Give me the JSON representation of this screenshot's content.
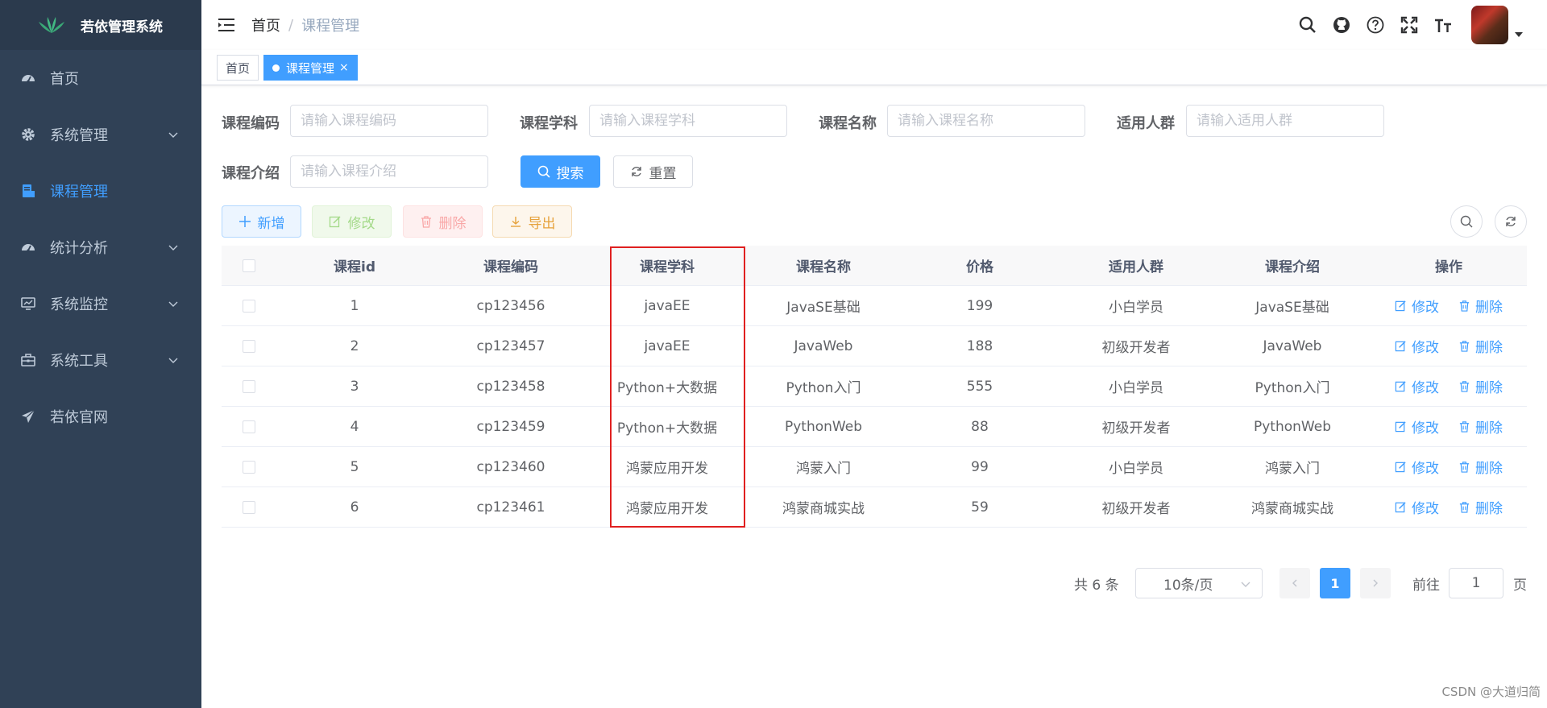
{
  "app": {
    "title": "若依管理系统"
  },
  "sidebar": {
    "items": [
      {
        "label": "首页",
        "icon": "dashboard-icon",
        "active": false,
        "expandable": false
      },
      {
        "label": "系统管理",
        "icon": "gear-icon",
        "active": false,
        "expandable": true
      },
      {
        "label": "课程管理",
        "icon": "course-icon",
        "active": true,
        "expandable": false
      },
      {
        "label": "统计分析",
        "icon": "dashboard-icon",
        "active": false,
        "expandable": true
      },
      {
        "label": "系统监控",
        "icon": "monitor-icon",
        "active": false,
        "expandable": true
      },
      {
        "label": "系统工具",
        "icon": "toolbox-icon",
        "active": false,
        "expandable": true
      },
      {
        "label": "若依官网",
        "icon": "paper-plane-icon",
        "active": false,
        "expandable": false
      }
    ]
  },
  "header": {
    "breadcrumb_home": "首页",
    "breadcrumb_sep": "/",
    "breadcrumb_current": "课程管理",
    "icons": [
      "search-icon",
      "github-icon",
      "question-icon",
      "fullscreen-icon",
      "font-size-icon"
    ]
  },
  "tags": {
    "home": "首页",
    "current": "课程管理",
    "close": "×"
  },
  "search": {
    "code_label": "课程编码",
    "code_placeholder": "请输入课程编码",
    "subject_label": "课程学科",
    "subject_placeholder": "请输入课程学科",
    "name_label": "课程名称",
    "name_placeholder": "请输入课程名称",
    "crowd_label": "适用人群",
    "crowd_placeholder": "请输入适用人群",
    "intro_label": "课程介绍",
    "intro_placeholder": "请输入课程介绍",
    "search_btn": "搜索",
    "reset_btn": "重置"
  },
  "toolbar": {
    "add": "新增",
    "edit": "修改",
    "delete": "删除",
    "export": "导出"
  },
  "table": {
    "headers": [
      "课程id",
      "课程编码",
      "课程学科",
      "课程名称",
      "价格",
      "适用人群",
      "课程介绍",
      "操作"
    ],
    "rows": [
      {
        "id": "1",
        "code": "cp123456",
        "subject": "javaEE",
        "name": "JavaSE基础",
        "price": "199",
        "crowd": "小白学员",
        "intro": "JavaSE基础"
      },
      {
        "id": "2",
        "code": "cp123457",
        "subject": "javaEE",
        "name": "JavaWeb",
        "price": "188",
        "crowd": "初级开发者",
        "intro": "JavaWeb"
      },
      {
        "id": "3",
        "code": "cp123458",
        "subject": "Python+大数据",
        "name": "Python入门",
        "price": "555",
        "crowd": "小白学员",
        "intro": "Python入门"
      },
      {
        "id": "4",
        "code": "cp123459",
        "subject": "Python+大数据",
        "name": "PythonWeb",
        "price": "88",
        "crowd": "初级开发者",
        "intro": "PythonWeb"
      },
      {
        "id": "5",
        "code": "cp123460",
        "subject": "鸿蒙应用开发",
        "name": "鸿蒙入门",
        "price": "99",
        "crowd": "小白学员",
        "intro": "鸿蒙入门"
      },
      {
        "id": "6",
        "code": "cp123461",
        "subject": "鸿蒙应用开发",
        "name": "鸿蒙商城实战",
        "price": "59",
        "crowd": "初级开发者",
        "intro": "鸿蒙商城实战"
      }
    ],
    "op_edit": "修改",
    "op_delete": "删除"
  },
  "pagination": {
    "total": "共 6 条",
    "page_size": "10条/页",
    "current_page": "1",
    "goto_label": "前往",
    "goto_value": "1",
    "page_suffix": "页"
  },
  "watermark": "CSDN @大道归简",
  "colors": {
    "primary": "#409eff",
    "sidebar_bg": "#304156",
    "highlight": "#e02020"
  }
}
